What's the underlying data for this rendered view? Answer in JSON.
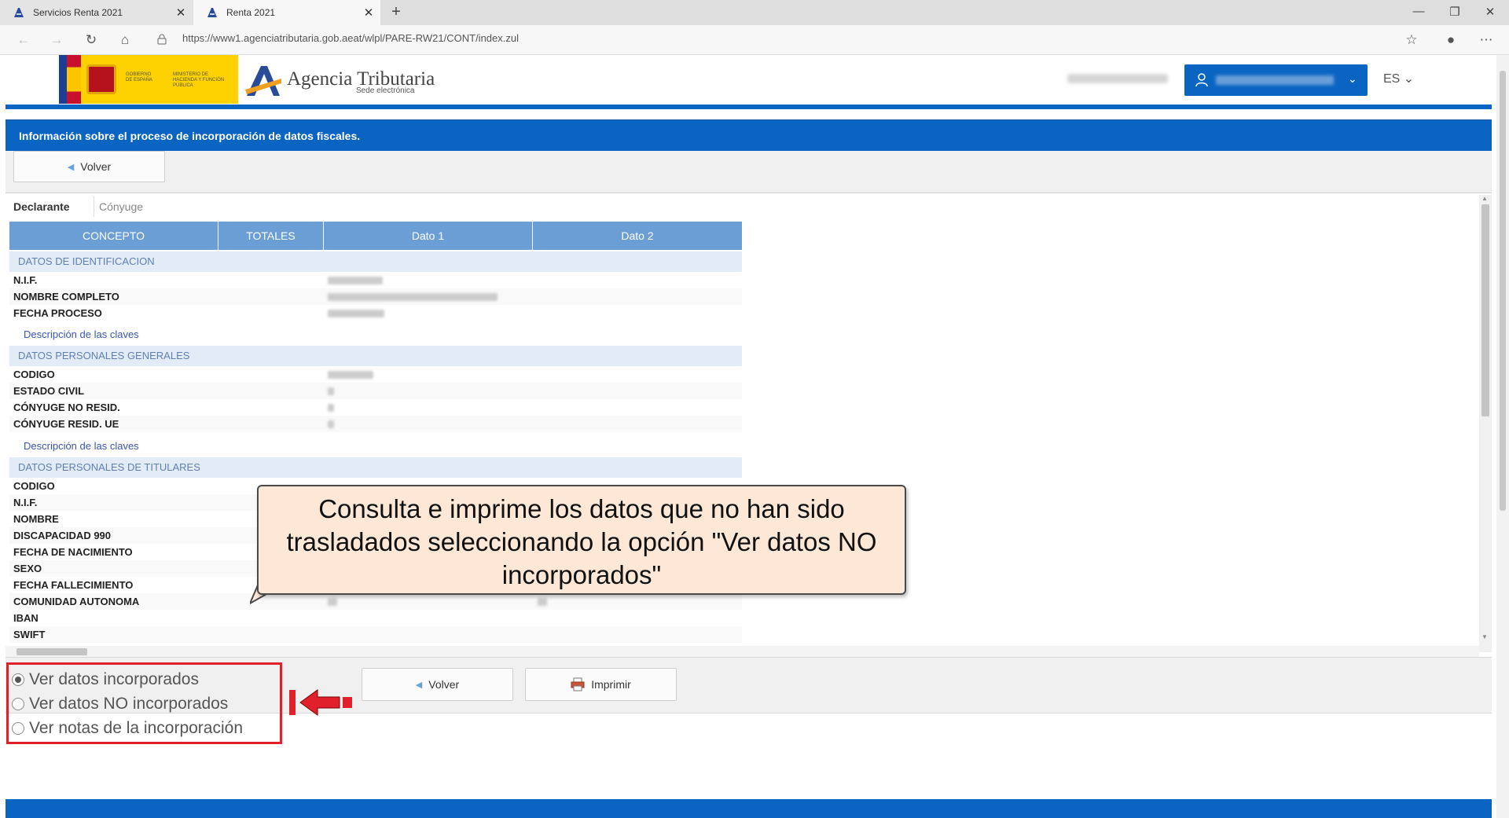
{
  "browser": {
    "tabs": [
      {
        "label": "Servicios Renta 2021"
      },
      {
        "label": "Renta 2021"
      }
    ],
    "url": "https://www1.agenciatributaria.gob.aeat/wlpl/PARE-RW21/CONT/index.zul"
  },
  "header": {
    "gobierno": "GOBIERNO DE ESPAÑA",
    "ministerio": "MINISTERIO DE HACIENDA Y FUNCIÓN PÚBLICA",
    "agencia_title": "Agencia Tributaria",
    "agencia_sub": "Sede electrónica",
    "lang": "ES"
  },
  "info_bar": {
    "title": "Información sobre el proceso de incorporación de datos fiscales."
  },
  "buttons": {
    "volver": "Volver",
    "imprimir": "Imprimir"
  },
  "tabs": {
    "declarante": "Declarante",
    "conyuge": "Cónyuge"
  },
  "table": {
    "headers": [
      "CONCEPTO",
      "TOTALES",
      "Dato 1",
      "Dato 2"
    ],
    "sections": [
      {
        "title": "DATOS DE IDENTIFICACION",
        "rows": [
          "N.I.F.",
          "NOMBRE COMPLETO",
          "FECHA PROCESO"
        ],
        "link": "Descripción de las claves"
      },
      {
        "title": "DATOS PERSONALES GENERALES",
        "rows": [
          "CODIGO",
          "ESTADO CIVIL",
          "CÓNYUGE NO RESID.",
          "CÓNYUGE RESID. UE"
        ],
        "link": "Descripción de las claves"
      },
      {
        "title": "DATOS PERSONALES DE TITULARES",
        "rows": [
          "CODIGO",
          "N.I.F.",
          "NOMBRE",
          "DISCAPACIDAD 990",
          "FECHA DE NACIMIENTO",
          "SEXO",
          "FECHA FALLECIMIENTO",
          "COMUNIDAD AUTONOMA",
          "IBAN",
          "SWIFT"
        ]
      }
    ]
  },
  "callout": {
    "text": "Consulta e imprime los datos que no han sido trasladados seleccionando la opción \"Ver datos NO incorporados\""
  },
  "options": [
    {
      "label": "Ver datos incorporados",
      "selected": true
    },
    {
      "label": "Ver datos NO incorporados",
      "selected": false
    },
    {
      "label": "Ver notas de la incorporación",
      "selected": false
    }
  ],
  "colors": {
    "brand_blue": "#0a64c2",
    "header_table": "#6c9ed6",
    "highlight_red": "#e0202a"
  }
}
